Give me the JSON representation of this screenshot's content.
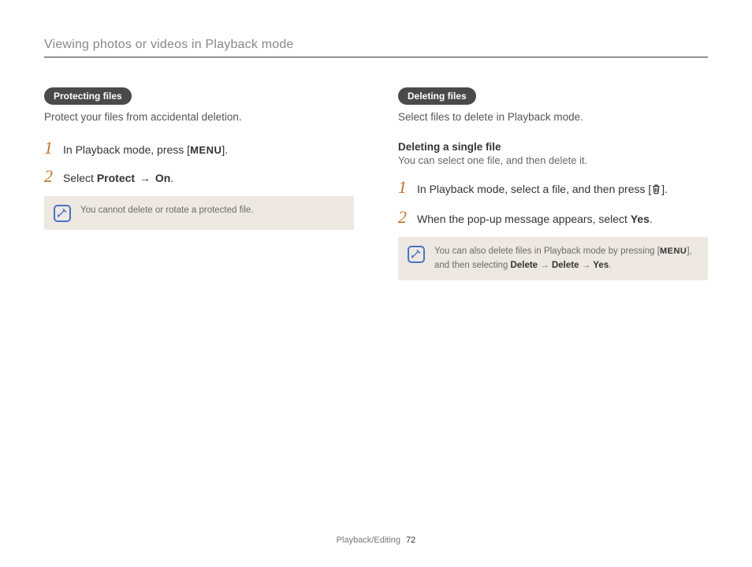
{
  "header": "Viewing photos or videos in Playback mode",
  "left": {
    "pill": "Protecting files",
    "desc": "Protect your files from accidental deletion.",
    "step1_a": "In Playback mode, press [",
    "step1_menu": "MENU",
    "step1_b": "].",
    "step2_a": "Select ",
    "step2_protect": "Protect",
    "step2_arrow": " → ",
    "step2_on": "On",
    "step2_b": ".",
    "note": "You cannot delete or rotate a protected file."
  },
  "right": {
    "pill": "Deleting files",
    "desc": "Select files to delete in Playback mode.",
    "sub_heading": "Deleting a single file",
    "sub_desc": "You can select one file, and then delete it.",
    "step1_a": "In Playback mode, select a file, and then press [",
    "step1_b": "].",
    "step2_a": "When the pop-up message appears, select ",
    "step2_yes": "Yes",
    "step2_b": ".",
    "note_a": "You can also delete files in Playback mode by pressing [",
    "note_menu": "MENU",
    "note_b": "], and then selecting ",
    "note_delete1": "Delete",
    "note_arrow": " → ",
    "note_delete2": "Delete",
    "note_yes": "Yes",
    "note_c": "."
  },
  "footer": {
    "section": "Playback/Editing",
    "page": "72"
  },
  "nums": {
    "one": "1",
    "two": "2"
  }
}
